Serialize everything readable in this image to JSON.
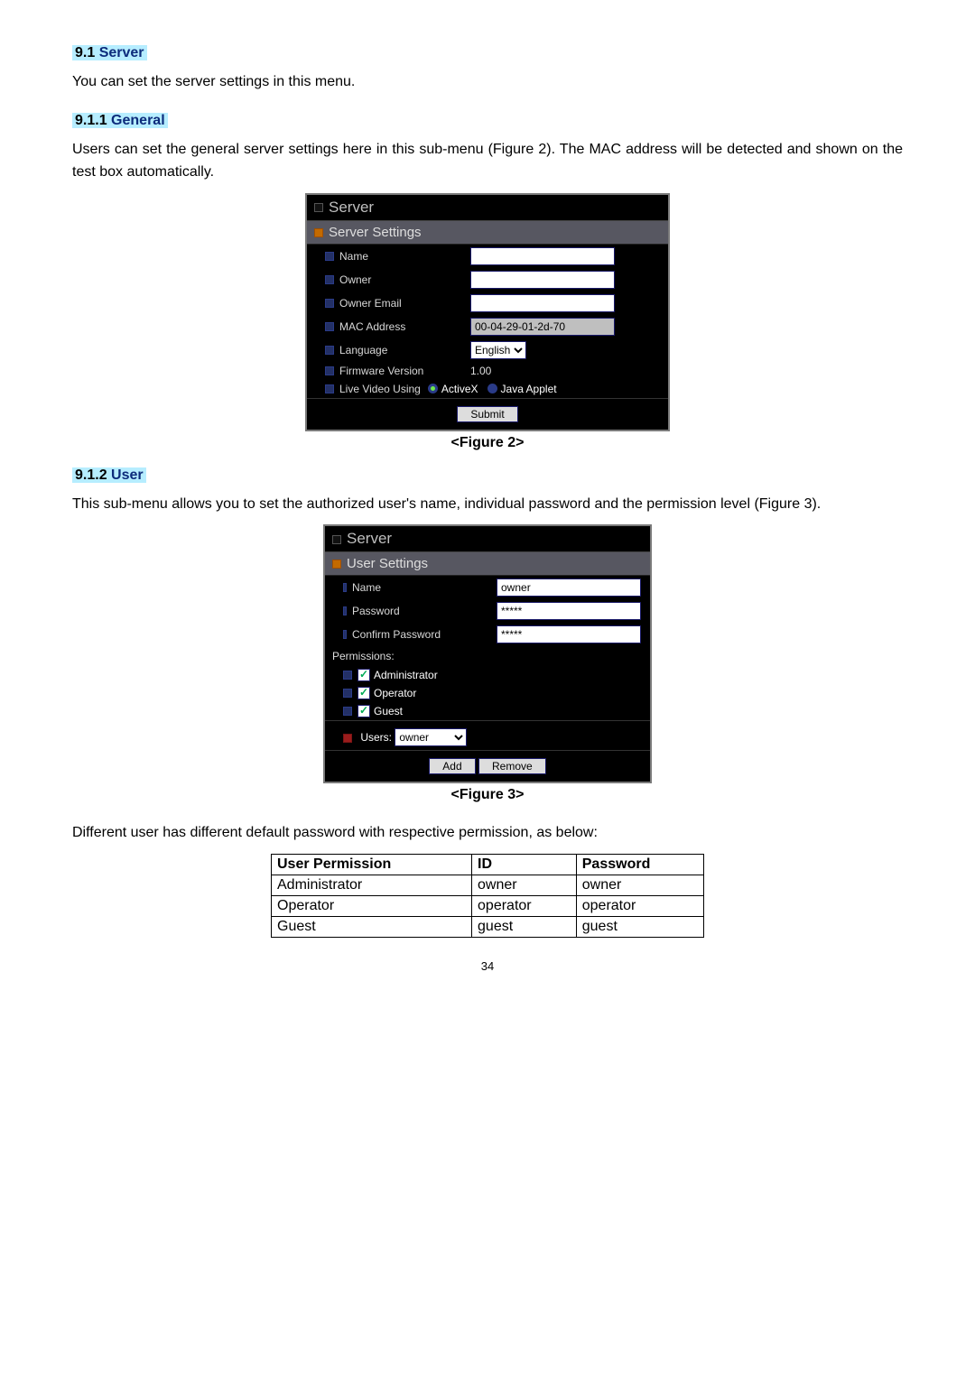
{
  "sections": {
    "s91_num": "9.1",
    "s91_title": "Server",
    "s91_body": "You can set the server settings in this menu.",
    "s911_num": "9.1.1",
    "s911_title": "General",
    "s911_body": "Users can set the general server settings here in this sub-menu (Figure 2). The MAC address will be detected and shown on the test box automatically.",
    "s912_num": "9.1.2",
    "s912_title": "User",
    "s912_body": "This sub-menu allows you to set the authorized user's name, individual password and the permission level (Figure 3).",
    "diff_para": "Different user has different default password with respective permission, as below:"
  },
  "fig2": {
    "panel_title": "Server",
    "sub_title": "Server Settings",
    "rows": {
      "name": "Name",
      "owner": "Owner",
      "owner_email": "Owner Email",
      "mac": "MAC Address",
      "mac_val": "00-04-29-01-2d-70",
      "lang": "Language",
      "lang_val": "English",
      "fw": "Firmware Version",
      "fw_val": "1.00",
      "lvu": "Live Video Using",
      "activex": "ActiveX",
      "java": "Java Applet"
    },
    "submit": "Submit",
    "caption": "<Figure 2>"
  },
  "fig3": {
    "panel_title": "Server",
    "sub_title": "User Settings",
    "rows": {
      "name": "Name",
      "name_val": "owner",
      "pwd": "Password",
      "pwd_val": "*****",
      "cpwd": "Confirm Password",
      "cpwd_val": "*****"
    },
    "perm_title": "Permissions:",
    "perm": {
      "admin": "Administrator",
      "op": "Operator",
      "guest": "Guest"
    },
    "users_label": "Users:",
    "users_val": "owner",
    "add": "Add",
    "remove": "Remove",
    "caption": "<Figure 3>"
  },
  "permtable": {
    "h1": "User Permission",
    "h2": "ID",
    "h3": "Password",
    "rows": [
      {
        "a": "Administrator",
        "b": "owner",
        "c": "owner"
      },
      {
        "a": "Operator",
        "b": "operator",
        "c": "operator"
      },
      {
        "a": "Guest",
        "b": "guest",
        "c": "guest"
      }
    ]
  },
  "page_number": "34"
}
